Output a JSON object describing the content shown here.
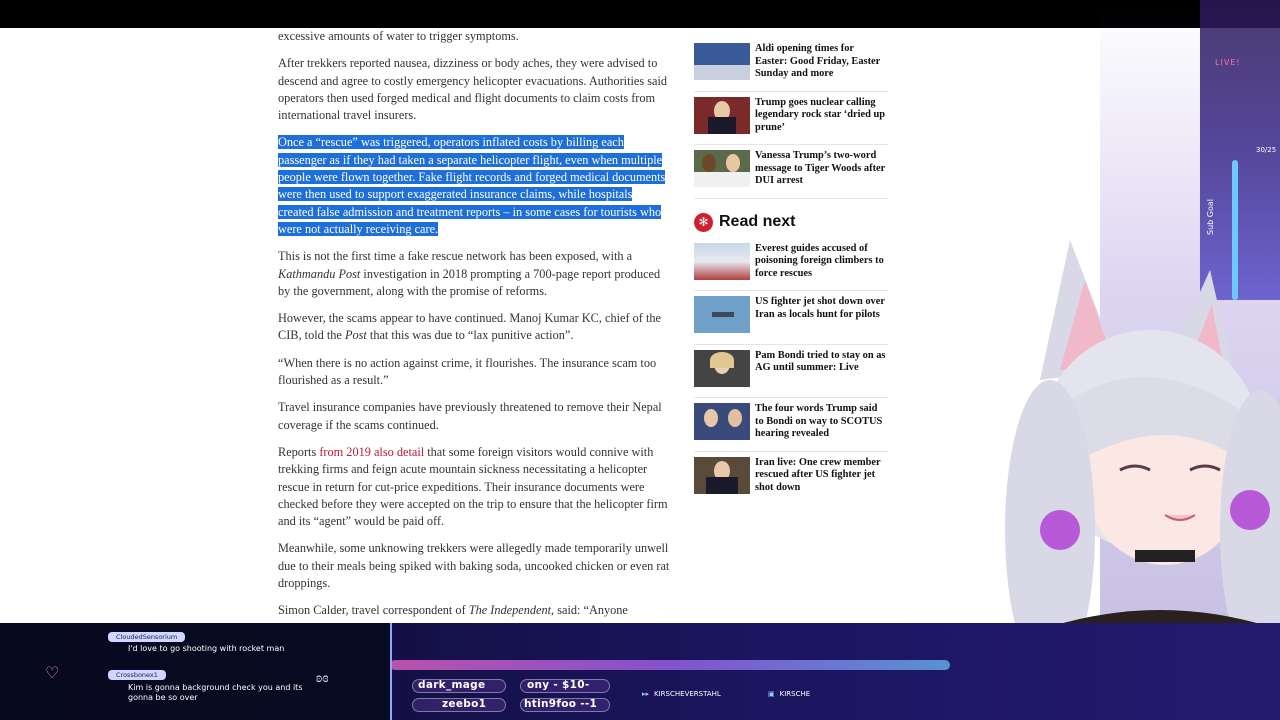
{
  "article": {
    "p0": "excessive amounts of water to trigger symptoms.",
    "p1": "After trekkers reported nausea, dizziness or body aches, they were advised to descend and agree to costly emergency helicopter evacuations. Authorities said operators then used forged medical and flight documents to claim costs from international travel insurers.",
    "p2_highlight": "Once a “rescue” was triggered, operators inflated costs by billing each passenger as if they had taken a separate helicopter flight, even when multiple people were flown together. Fake flight records and forged medical documents were then used to support exaggerated insurance claims, while hospitals created false admission and treatment reports – in some cases for tourists who were not actually receiving care.",
    "p3a": "This is not the first time a fake rescue network has been exposed, with a ",
    "p3_em": "Kathmandu Post",
    "p3b": " investigation in 2018 prompting a 700-page report produced by the government, along with the promise of reforms.",
    "p4a": "However, the scams appear to have continued. Manoj Kumar KC, chief of the CIB, told the ",
    "p4_em": "Post",
    "p4b": " that this was due to “lax punitive action”.",
    "p5": "“When there is no action against crime, it flourishes. The insurance scam too flourished as a result.”",
    "p6": "Travel insurance companies have previously threatened to remove their Nepal coverage if the scams continued.",
    "p7a": "Reports ",
    "p7_link": "from 2019 also detail",
    "p7b": " that some foreign visitors would connive with trekking firms and feign acute mountain sickness necessitating a helicopter rescue in return for cut-price expeditions. Their insurance documents were checked before they were accepted on the trip to ensure that the helicopter firm and its “agent” would be paid off.",
    "p8": "Meanwhile, some unknowing trekkers were allegedly made temporarily unwell due to their meals being spiked with baking soda, uncooked chicken or even rat droppings.",
    "p9a": "Simon Calder, travel correspondent of ",
    "p9_em": "The Independent",
    "p9b": ", said: “Anyone"
  },
  "rail_top": [
    {
      "title": "Aldi opening times for Easter: Good Friday, Easter Sunday and more",
      "thumb_color": "#3a5a9a"
    },
    {
      "title": "Trump goes nuclear calling legendary rock star ‘dried up prune’",
      "thumb_color": "#7a2a2a"
    },
    {
      "title": "Vanessa Trump’s two-word message to Tiger Woods after DUI arrest",
      "thumb_color": "#5a6a4a"
    }
  ],
  "read_next": {
    "label": "Read next",
    "items": [
      {
        "title": "Everest guides accused of poisoning foreign climbers to force rescues",
        "thumb_color": "#b04040"
      },
      {
        "title": "US fighter jet shot down over Iran as locals hunt for pilots",
        "thumb_color": "#6fa0c8"
      },
      {
        "title": "Pam Bondi tried to stay on as AG until summer: Live",
        "thumb_color": "#444444"
      },
      {
        "title": "The four words Trump said to Bondi on way to SCOTUS hearing revealed",
        "thumb_color": "#3a4a7a"
      },
      {
        "title": "Iran live: One crew member rescued after US fighter jet shot down",
        "thumb_color": "#5a4a3a"
      }
    ]
  },
  "overlay": {
    "live": "LIVE!",
    "goal_count": "30/25",
    "goal_label": "Sub Goal"
  },
  "chat": [
    {
      "user": "CloudedSensorium",
      "message": "I'd love to go shooting with rocket man"
    },
    {
      "user": "Crossbonex1",
      "message": "Kim is gonna background check you and its gonna be so over"
    }
  ],
  "ticker": [
    "dark_mage",
    "ony - $10-",
    "zeebo1",
    "htin9foo --1"
  ],
  "socials": [
    "KIRSCHEVERSTAHL",
    "KIRSCHE"
  ]
}
